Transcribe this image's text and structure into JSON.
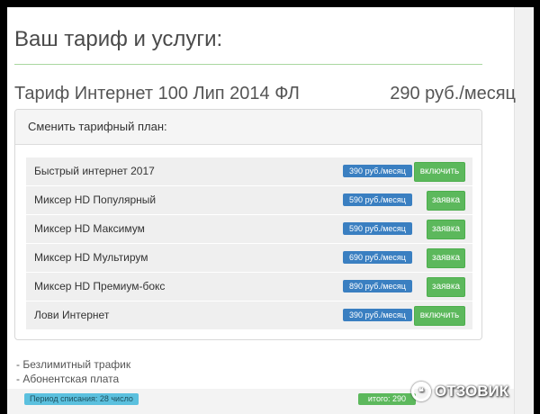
{
  "page": {
    "heading": "Ваш тариф и услуги:"
  },
  "tariff": {
    "name": "Тариф Интернет 100 Лип 2014 ФЛ",
    "price": "290 руб./месяц"
  },
  "change_plan": {
    "header": "Сменить тарифный план:",
    "plans": [
      {
        "name": "Быстрый интернет 2017",
        "price": "390 руб./месяц",
        "action": "включить"
      },
      {
        "name": "Миксер HD Популярный",
        "price": "590 руб./месяц",
        "action": "заявка"
      },
      {
        "name": "Миксер HD Максимум",
        "price": "590 руб./месяц",
        "action": "заявка"
      },
      {
        "name": "Миксер HD Мультирум",
        "price": "690 руб./месяц",
        "action": "заявка"
      },
      {
        "name": "Миксер HD Премиум-бокс",
        "price": "890 руб./месяц",
        "action": "заявка"
      },
      {
        "name": "Лови Интернет",
        "price": "390 руб./месяц",
        "action": "включить"
      }
    ]
  },
  "features": [
    "- Безлимитный трафик",
    "- Абонентская плата"
  ],
  "footer": {
    "period": "Период списания: 28 число",
    "total": "итого: 290"
  },
  "watermark": {
    "text": "ОТЗОВИК",
    "symbol": "❝"
  },
  "colors": {
    "price_badge": "#3a7fc1",
    "action_button": "#5cb85c",
    "period_badge": "#5bc0de",
    "divider": "#a9d7a0"
  }
}
